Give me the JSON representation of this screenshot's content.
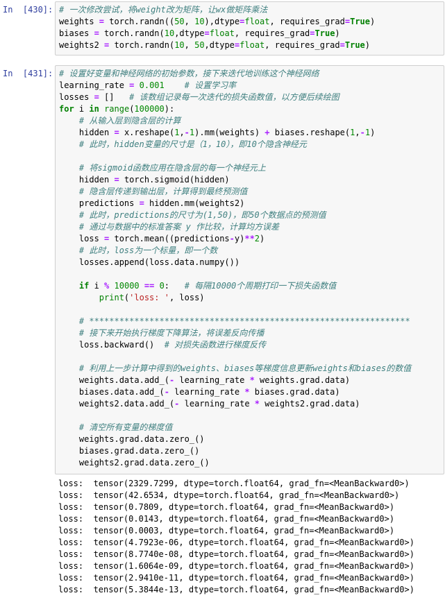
{
  "cell1": {
    "prompt": "In  [430]:",
    "lines": [
      [
        [
          "cm",
          "# 一次修改尝试，将weight改为矩阵，让wx做矩阵乘法"
        ]
      ],
      [
        [
          "t",
          "weights "
        ],
        [
          "op",
          "="
        ],
        [
          "t",
          " torch.randn(("
        ],
        [
          "nm",
          "50"
        ],
        [
          "t",
          ", "
        ],
        [
          "nm",
          "10"
        ],
        [
          "t",
          "),dtype"
        ],
        [
          "op",
          "="
        ],
        [
          "bi",
          "float"
        ],
        [
          "t",
          ", requires_grad"
        ],
        [
          "op",
          "="
        ],
        [
          "kw",
          "True"
        ],
        [
          "t",
          ")"
        ]
      ],
      [
        [
          "t",
          "biases "
        ],
        [
          "op",
          "="
        ],
        [
          "t",
          " torch.randn("
        ],
        [
          "nm",
          "10"
        ],
        [
          "t",
          ",dtype"
        ],
        [
          "op",
          "="
        ],
        [
          "bi",
          "float"
        ],
        [
          "t",
          ", requires_grad"
        ],
        [
          "op",
          "="
        ],
        [
          "kw",
          "True"
        ],
        [
          "t",
          ")"
        ]
      ],
      [
        [
          "t",
          "weights2 "
        ],
        [
          "op",
          "="
        ],
        [
          "t",
          " torch.randn("
        ],
        [
          "nm",
          "10"
        ],
        [
          "t",
          ", "
        ],
        [
          "nm",
          "50"
        ],
        [
          "t",
          ",dtype"
        ],
        [
          "op",
          "="
        ],
        [
          "bi",
          "float"
        ],
        [
          "t",
          ", requires_grad"
        ],
        [
          "op",
          "="
        ],
        [
          "kw",
          "True"
        ],
        [
          "t",
          ")"
        ]
      ]
    ]
  },
  "cell2": {
    "prompt": "In  [431]:",
    "lines": [
      [
        [
          "cm",
          "# 设置好变量和神经网络的初始参数，接下来迭代地训练这个神经网络"
        ]
      ],
      [
        [
          "t",
          "learning_rate "
        ],
        [
          "op",
          "="
        ],
        [
          "t",
          " "
        ],
        [
          "nm",
          "0.001"
        ],
        [
          "t",
          "    "
        ],
        [
          "cm",
          "# 设置学习率"
        ]
      ],
      [
        [
          "t",
          "losses "
        ],
        [
          "op",
          "="
        ],
        [
          "t",
          " []   "
        ],
        [
          "cm",
          "# 该数组记录每一次迭代的损失函数值，以方便后续绘图"
        ]
      ],
      [
        [
          "kw",
          "for"
        ],
        [
          "t",
          " i "
        ],
        [
          "kw",
          "in"
        ],
        [
          "t",
          " "
        ],
        [
          "bi",
          "range"
        ],
        [
          "t",
          "("
        ],
        [
          "nm",
          "100000"
        ],
        [
          "t",
          "):"
        ]
      ],
      [
        [
          "t",
          "    "
        ],
        [
          "cm",
          "# 从输入层到隐含层的计算"
        ]
      ],
      [
        [
          "t",
          "    hidden "
        ],
        [
          "op",
          "="
        ],
        [
          "t",
          " x.reshape("
        ],
        [
          "nm",
          "1"
        ],
        [
          "t",
          ","
        ],
        [
          "op",
          "-"
        ],
        [
          "nm",
          "1"
        ],
        [
          "t",
          ").mm(weights) "
        ],
        [
          "op",
          "+"
        ],
        [
          "t",
          " biases.reshape("
        ],
        [
          "nm",
          "1"
        ],
        [
          "t",
          ","
        ],
        [
          "op",
          "-"
        ],
        [
          "nm",
          "1"
        ],
        [
          "t",
          ")"
        ]
      ],
      [
        [
          "t",
          "    "
        ],
        [
          "cm",
          "# 此时，hidden变量的尺寸是（1，10），即10个隐含神经元"
        ]
      ],
      [
        [
          "t",
          ""
        ]
      ],
      [
        [
          "t",
          "    "
        ],
        [
          "cm",
          "# 将sigmoid函数应用在隐含层的每一个神经元上"
        ]
      ],
      [
        [
          "t",
          "    hidden "
        ],
        [
          "op",
          "="
        ],
        [
          "t",
          " torch.sigmoid(hidden)"
        ]
      ],
      [
        [
          "t",
          "    "
        ],
        [
          "cm",
          "# 隐含层传递到输出层，计算得到最终预测值"
        ]
      ],
      [
        [
          "t",
          "    predictions "
        ],
        [
          "op",
          "="
        ],
        [
          "t",
          " hidden.mm(weights2)"
        ]
      ],
      [
        [
          "t",
          "    "
        ],
        [
          "cm",
          "# 此时，predictions的尺寸为(1,50)，即50个数据点的预测值"
        ]
      ],
      [
        [
          "t",
          "    "
        ],
        [
          "cm",
          "# 通过与数据中的标准答案 y 作比较，计算均方误差"
        ]
      ],
      [
        [
          "t",
          "    loss "
        ],
        [
          "op",
          "="
        ],
        [
          "t",
          " torch.mean((predictions"
        ],
        [
          "op",
          "-"
        ],
        [
          "t",
          "y)"
        ],
        [
          "op",
          "**"
        ],
        [
          "nm",
          "2"
        ],
        [
          "t",
          ")"
        ]
      ],
      [
        [
          "t",
          "    "
        ],
        [
          "cm",
          "# 此时，loss为一个标量，即一个数"
        ]
      ],
      [
        [
          "t",
          "    losses.append(loss.data.numpy())"
        ]
      ],
      [
        [
          "t",
          ""
        ]
      ],
      [
        [
          "t",
          "    "
        ],
        [
          "kw",
          "if"
        ],
        [
          "t",
          " i "
        ],
        [
          "op",
          "%"
        ],
        [
          "t",
          " "
        ],
        [
          "nm",
          "10000"
        ],
        [
          "t",
          " "
        ],
        [
          "op",
          "=="
        ],
        [
          "t",
          " "
        ],
        [
          "nm",
          "0"
        ],
        [
          "t",
          ":   "
        ],
        [
          "cm",
          "# 每隔10000个周期打印一下损失函数值"
        ]
      ],
      [
        [
          "t",
          "        "
        ],
        [
          "bi",
          "print"
        ],
        [
          "t",
          "("
        ],
        [
          "st",
          "'loss: '"
        ],
        [
          "t",
          ", loss)"
        ]
      ],
      [
        [
          "t",
          ""
        ]
      ],
      [
        [
          "t",
          "    "
        ],
        [
          "cm",
          "# ****************************************************************"
        ]
      ],
      [
        [
          "t",
          "    "
        ],
        [
          "cm",
          "# 接下来开始执行梯度下降算法，将误差反向传播"
        ]
      ],
      [
        [
          "t",
          "    loss.backward()  "
        ],
        [
          "cm",
          "# 对损失函数进行梯度反传"
        ]
      ],
      [
        [
          "t",
          ""
        ]
      ],
      [
        [
          "t",
          "    "
        ],
        [
          "cm",
          "# 利用上一步计算中得到的weights、biases等梯度信息更新weights和biases的数值"
        ]
      ],
      [
        [
          "t",
          "    weights.data.add_("
        ],
        [
          "op",
          "-"
        ],
        [
          "t",
          " learning_rate "
        ],
        [
          "op",
          "*"
        ],
        [
          "t",
          " weights.grad.data)"
        ]
      ],
      [
        [
          "t",
          "    biases.data.add_("
        ],
        [
          "op",
          "-"
        ],
        [
          "t",
          " learning_rate "
        ],
        [
          "op",
          "*"
        ],
        [
          "t",
          " biases.grad.data)"
        ]
      ],
      [
        [
          "t",
          "    weights2.data.add_("
        ],
        [
          "op",
          "-"
        ],
        [
          "t",
          " learning_rate "
        ],
        [
          "op",
          "*"
        ],
        [
          "t",
          " weights2.grad.data)"
        ]
      ],
      [
        [
          "t",
          ""
        ]
      ],
      [
        [
          "t",
          "    "
        ],
        [
          "cm",
          "# 清空所有变量的梯度值"
        ]
      ],
      [
        [
          "t",
          "    weights.grad.data.zero_()"
        ]
      ],
      [
        [
          "t",
          "    biases.grad.data.zero_()"
        ]
      ],
      [
        [
          "t",
          "    weights2.grad.data.zero_()"
        ]
      ]
    ]
  },
  "output": [
    "loss:  tensor(2329.7299, dtype=torch.float64, grad_fn=<MeanBackward0>)",
    "loss:  tensor(42.6534, dtype=torch.float64, grad_fn=<MeanBackward0>)",
    "loss:  tensor(0.7809, dtype=torch.float64, grad_fn=<MeanBackward0>)",
    "loss:  tensor(0.0143, dtype=torch.float64, grad_fn=<MeanBackward0>)",
    "loss:  tensor(0.0003, dtype=torch.float64, grad_fn=<MeanBackward0>)",
    "loss:  tensor(4.7923e-06, dtype=torch.float64, grad_fn=<MeanBackward0>)",
    "loss:  tensor(8.7740e-08, dtype=torch.float64, grad_fn=<MeanBackward0>)",
    "loss:  tensor(1.6064e-09, dtype=torch.float64, grad_fn=<MeanBackward0>)",
    "loss:  tensor(2.9410e-11, dtype=torch.float64, grad_fn=<MeanBackward0>)",
    "loss:  tensor(5.3844e-13, dtype=torch.float64, grad_fn=<MeanBackward0>)"
  ]
}
